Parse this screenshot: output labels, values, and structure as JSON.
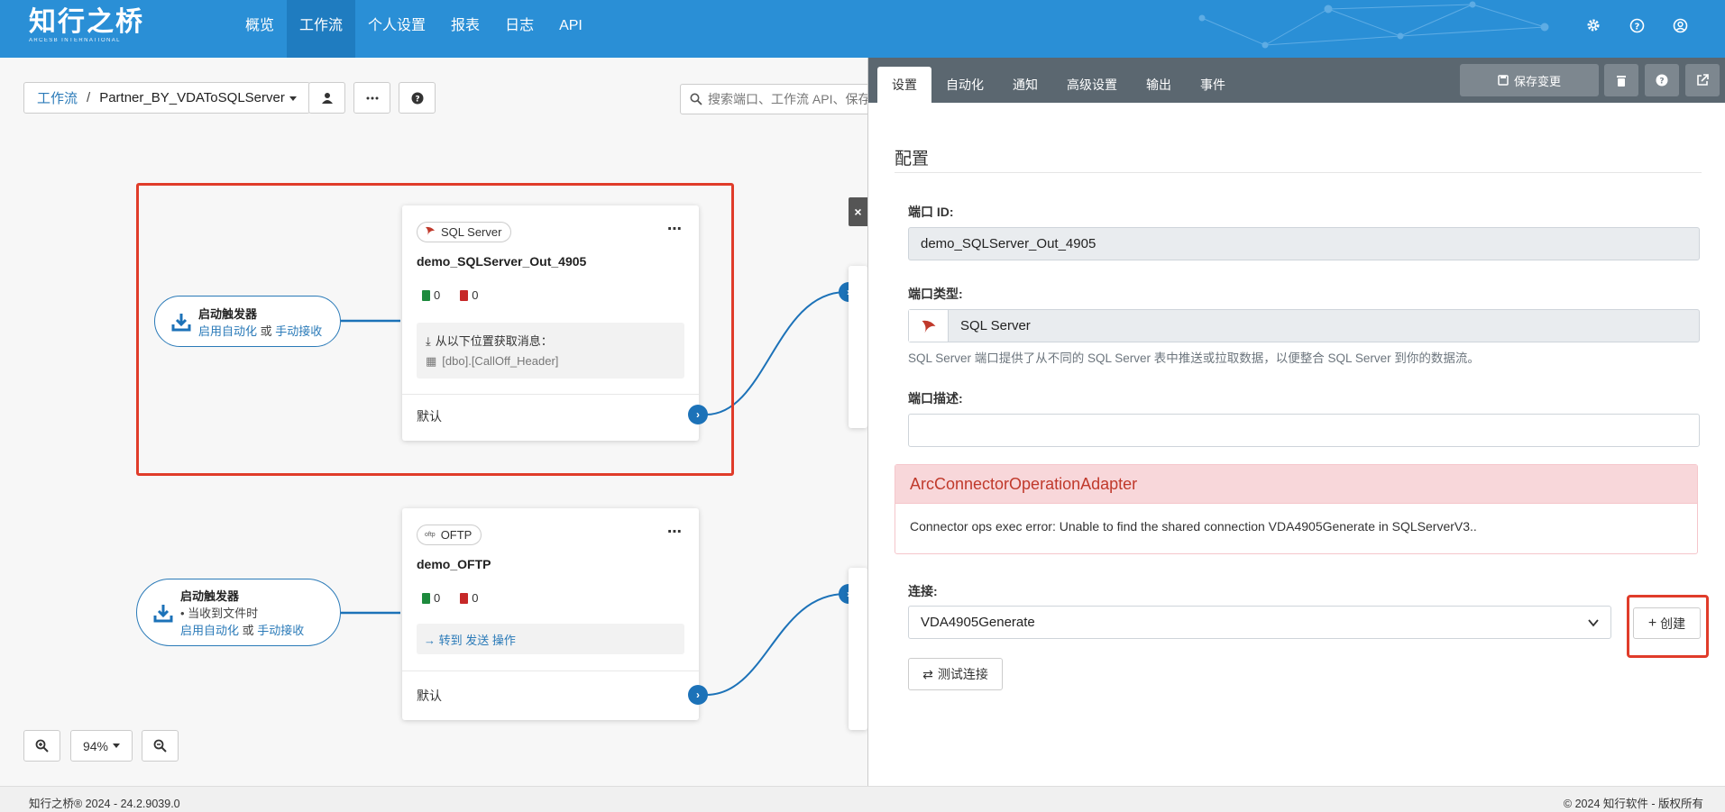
{
  "app": {
    "logo_cn": "知行之桥",
    "logo_en": "ARCESB INTERNATIONAL"
  },
  "nav": {
    "items": [
      {
        "label": "概览"
      },
      {
        "label": "工作流"
      },
      {
        "label": "个人设置"
      },
      {
        "label": "报表"
      },
      {
        "label": "日志"
      },
      {
        "label": "API"
      }
    ],
    "active": "工作流"
  },
  "breadcrumb": {
    "root": "工作流",
    "separator": "/",
    "current": "Partner_BY_VDAToSQLServer"
  },
  "search": {
    "placeholder": "搜索端口、工作流 API、保存"
  },
  "flow": {
    "triggers": [
      {
        "title": "启动触发器",
        "link1": "启用自动化",
        "or": "或",
        "link2": "手动接收"
      },
      {
        "title": "启动触发器",
        "bullet": "当收到文件时",
        "link1": "启用自动化",
        "or": "或",
        "link2": "手动接收"
      }
    ],
    "cards": [
      {
        "type_label": "SQL Server",
        "name": "demo_SQLServer_Out_4905",
        "sent_count": "0",
        "error_count": "0",
        "source_title": "从以下位置获取消息：",
        "source_table": "[dbo].[CallOff_Header]",
        "default_label": "默认"
      },
      {
        "type_label": "OFTP",
        "name": "demo_OFTP",
        "sent_count": "0",
        "error_count": "0",
        "goto_prefix": "→ 转到",
        "goto_link": "发送",
        "goto_suffix": "操作",
        "default_label": "默认"
      }
    ]
  },
  "zoom": {
    "level": "94%"
  },
  "panel": {
    "tabs": [
      {
        "label": "设置"
      },
      {
        "label": "自动化"
      },
      {
        "label": "通知"
      },
      {
        "label": "高级设置"
      },
      {
        "label": "输出"
      },
      {
        "label": "事件"
      }
    ],
    "save_label": "保存变更",
    "section_title": "配置",
    "port_id_label": "端口 ID:",
    "port_id_value": "demo_SQLServer_Out_4905",
    "port_type_label": "端口类型:",
    "port_type_value": "SQL Server",
    "port_type_help": "SQL Server 端口提供了从不同的 SQL Server 表中推送或拉取数据，以便整合 SQL Server 到你的数据流。",
    "port_desc_label": "端口描述:",
    "port_desc_value": "",
    "alert_title": "ArcConnectorOperationAdapter",
    "alert_message": "Connector ops exec error: Unable to find the shared connection VDA4905Generate in SQLServerV3..",
    "connection_label": "连接:",
    "connection_value": "VDA4905Generate",
    "create_label": "创建",
    "test_label": "测试连接"
  },
  "footer": {
    "left": "知行之桥® 2024 - 24.2.9039.0",
    "right": "© 2024 知行软件 - 版权所有"
  },
  "colors": {
    "topbar": "#2a8fd6",
    "accent": "#1c72b8",
    "highlight": "#e03c2a",
    "panel_header": "#5b6770"
  }
}
